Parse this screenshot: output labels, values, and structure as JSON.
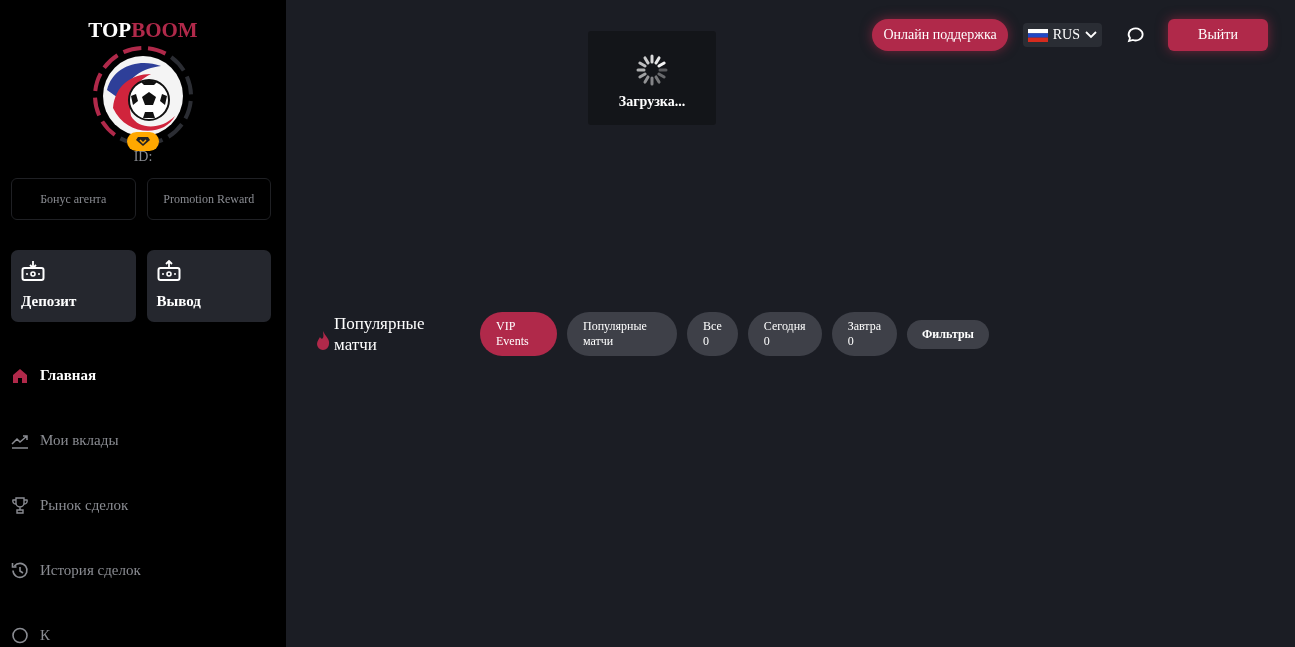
{
  "sidebar": {
    "logo": {
      "first": "TOP",
      "second": "BOOM"
    },
    "profile": {
      "id_label": "ID:"
    },
    "links": [
      "Бонус агента",
      "Promotion Reward"
    ],
    "actions": [
      {
        "kind": "deposit",
        "label": "Депозит"
      },
      {
        "kind": "withdraw",
        "label": "Вывод"
      }
    ],
    "items": [
      {
        "kind": "home",
        "label": "Главная",
        "selected": true
      },
      {
        "kind": "chart",
        "label": "Мои вклады",
        "selected": false
      },
      {
        "kind": "trophy",
        "label": "Рынок сделок",
        "selected": false
      },
      {
        "kind": "history",
        "label": "История сделок",
        "selected": false
      },
      {
        "kind": "circle",
        "label": "К",
        "selected": false
      }
    ]
  },
  "header": {
    "support": "Онлайн поддержка",
    "language": "RUS",
    "logout": "Выйти"
  },
  "matches": {
    "title": "Популярные матчи",
    "tabs": [
      {
        "label": "VIP Events",
        "selected": true
      },
      {
        "label": "Популярные матчи",
        "selected": false
      },
      {
        "label": "Все",
        "count": "0",
        "selected": false
      },
      {
        "label": "Сегодня",
        "count": "0",
        "selected": false
      },
      {
        "label": "Завтра",
        "count": "0",
        "selected": false
      }
    ],
    "filters": "Фильтры"
  },
  "loader": {
    "text": "Загрузка..."
  }
}
